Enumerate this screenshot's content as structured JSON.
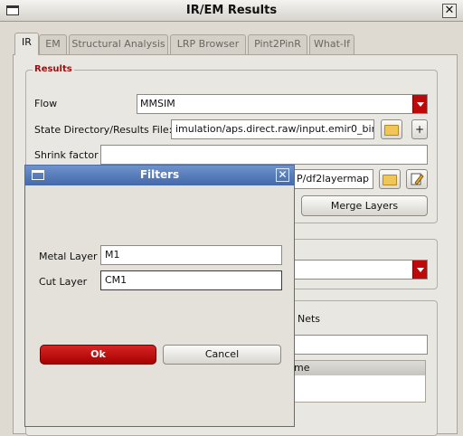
{
  "window": {
    "title": "IR/EM Results",
    "close_glyph": "✕"
  },
  "tabs": [
    {
      "label": "IR"
    },
    {
      "label": "EM"
    },
    {
      "label": "Structural Analysis"
    },
    {
      "label": "LRP Browser"
    },
    {
      "label": "Pint2PinR"
    },
    {
      "label": "What-If"
    }
  ],
  "results": {
    "group_label": "Results",
    "flow_label": "Flow",
    "flow_value": "MMSIM",
    "state_dir_label": "State Directory/Results File:",
    "state_dir_value": "imulation/aps.direct.raw/input.emir0_bin",
    "plus_glyph": "+",
    "shrink_label": "Shrink factor",
    "shrink_value": "",
    "layermap_value": "P/df2layermap",
    "merge_layers_label": "Merge Layers"
  },
  "lower": {
    "nets_label": "Nets",
    "table_header": "me"
  },
  "dialog": {
    "title": "Filters",
    "close_glyph": "✕",
    "metal_layer_label": "Metal Layer",
    "metal_layer_value": "M1",
    "cut_layer_label": "Cut Layer",
    "cut_layer_value": "CM1",
    "ok_label": "Ok",
    "cancel_label": "Cancel"
  },
  "colors": {
    "accent_red": "#c00808",
    "dialog_title_blue": "#4469aa"
  }
}
